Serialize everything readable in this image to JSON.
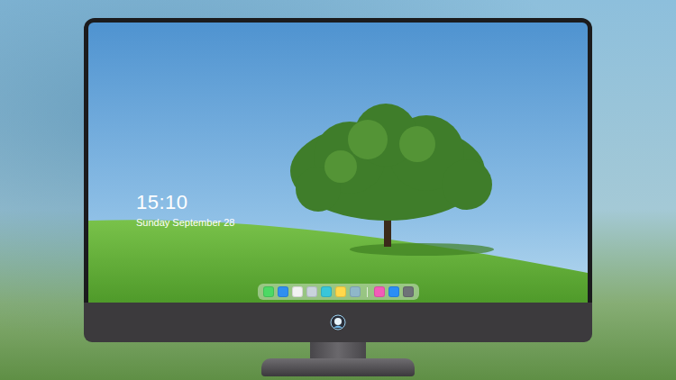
{
  "lock_screen": {
    "time": "15:10",
    "date": "Sunday September 28"
  },
  "dock": {
    "items": [
      {
        "kind": "app",
        "color": "#4cd964"
      },
      {
        "kind": "app",
        "color": "#2f8ff0"
      },
      {
        "kind": "app",
        "color": "#f2f2f2"
      },
      {
        "kind": "app",
        "color": "#c9d3dc"
      },
      {
        "kind": "app",
        "color": "#38c6d9"
      },
      {
        "kind": "app",
        "color": "#ffd84a"
      },
      {
        "kind": "app",
        "color": "#8fb7c9"
      },
      {
        "kind": "separator",
        "color": "#ffffff"
      },
      {
        "kind": "app",
        "color": "#f25cb8"
      },
      {
        "kind": "app",
        "color": "#2b8ef5"
      },
      {
        "kind": "app",
        "color": "#6e7277"
      }
    ]
  }
}
